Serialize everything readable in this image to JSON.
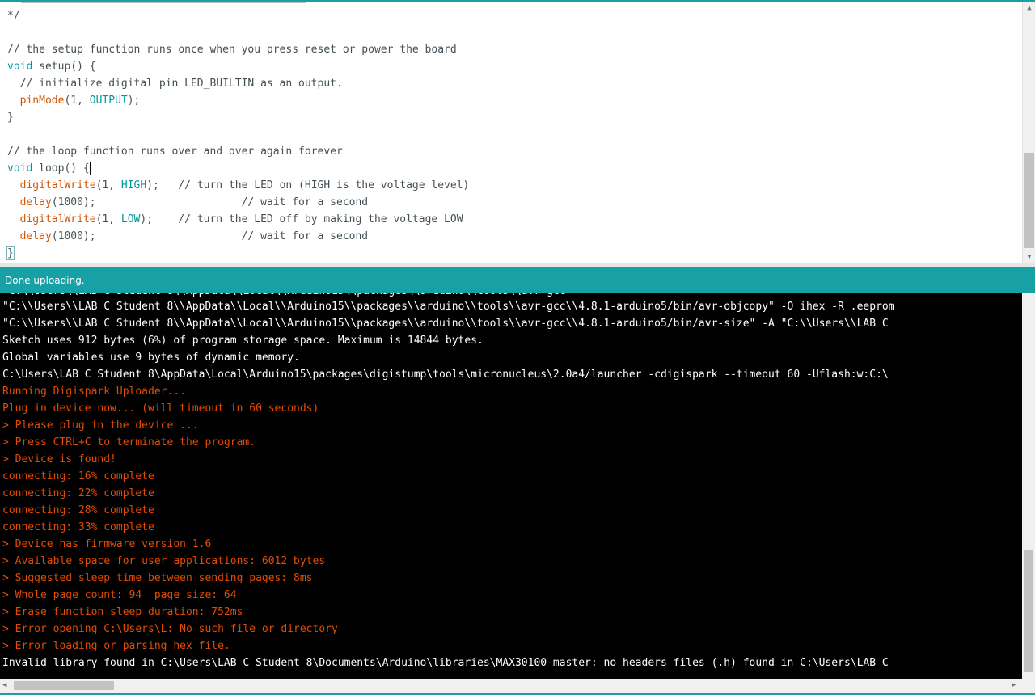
{
  "editor": {
    "lines": [
      {
        "text": "*/"
      },
      {
        "text": ""
      },
      {
        "text": "// the setup function runs once when you press reset or power the board"
      },
      {
        "kw": "void",
        "rest": " setup() {"
      },
      {
        "text": "  // initialize digital pin LED_BUILTIN as an output."
      },
      {
        "fn": "pinMode",
        "a": "(1, ",
        "const": "OUTPUT",
        "b": ");"
      },
      {
        "text": "}"
      },
      {
        "text": ""
      },
      {
        "text": "// the loop function runs over and over again forever"
      },
      {
        "kw": "void",
        "rest": " loop() {"
      },
      {
        "fn": "digitalWrite",
        "a": "(1, ",
        "const": "HIGH",
        "b": ");   // turn the LED on (HIGH is the voltage level)"
      },
      {
        "fn": "delay",
        "a": "(1000);                       // wait for a second"
      },
      {
        "fn": "digitalWrite",
        "a": "(1, ",
        "const": "LOW",
        "b": ");    // turn the LED off by making the voltage LOW"
      },
      {
        "fn": "delay",
        "a": "(1000);                       // wait for a second"
      },
      {
        "text": "}"
      }
    ]
  },
  "status": {
    "text": "Done uploading."
  },
  "console": {
    "lines": [
      {
        "color": "white",
        "text": "\"C:\\\\Users\\\\LAB C Student 8\\\\AppData\\\\Local\\\\Arduino15\\\\packages\\\\arduino\\\\tools\\\\avr-gcc\\\\4.8.1-arduino5/bin/avr-objcopy\" -O ihex -R .eeprom"
      },
      {
        "color": "white",
        "text": "\"C:\\\\Users\\\\LAB C Student 8\\\\AppData\\\\Local\\\\Arduino15\\\\packages\\\\arduino\\\\tools\\\\avr-gcc\\\\4.8.1-arduino5/bin/avr-size\" -A \"C:\\\\Users\\\\LAB C"
      },
      {
        "color": "white",
        "text": "Sketch uses 912 bytes (6%) of program storage space. Maximum is 14844 bytes."
      },
      {
        "color": "white",
        "text": "Global variables use 9 bytes of dynamic memory."
      },
      {
        "color": "white",
        "text": "C:\\Users\\LAB C Student 8\\AppData\\Local\\Arduino15\\packages\\digistump\\tools\\micronucleus\\2.0a4/launcher -cdigispark --timeout 60 -Uflash:w:C:\\"
      },
      {
        "color": "orange",
        "text": "Running Digispark Uploader..."
      },
      {
        "color": "orange",
        "text": "Plug in device now... (will timeout in 60 seconds)"
      },
      {
        "color": "orange",
        "text": "> Please plug in the device ..."
      },
      {
        "color": "orange",
        "text": "> Press CTRL+C to terminate the program."
      },
      {
        "color": "orange",
        "text": "> Device is found!"
      },
      {
        "color": "orange",
        "text": "connecting: 16% complete"
      },
      {
        "color": "orange",
        "text": "connecting: 22% complete"
      },
      {
        "color": "orange",
        "text": "connecting: 28% complete"
      },
      {
        "color": "orange",
        "text": "connecting: 33% complete"
      },
      {
        "color": "orange",
        "text": "> Device has firmware version 1.6"
      },
      {
        "color": "orange",
        "text": "> Available space for user applications: 6012 bytes"
      },
      {
        "color": "orange",
        "text": "> Suggested sleep time between sending pages: 8ms"
      },
      {
        "color": "orange",
        "text": "> Whole page count: 94  page size: 64"
      },
      {
        "color": "orange",
        "text": "> Erase function sleep duration: 752ms"
      },
      {
        "color": "orange",
        "text": "> Error opening C:\\Users\\L: No such file or directory"
      },
      {
        "color": "orange",
        "text": "> Error loading or parsing hex file."
      },
      {
        "color": "white",
        "text": "Invalid library found in C:\\Users\\LAB C Student 8\\Documents\\Arduino\\libraries\\MAX30100-master: no headers files (.h) found in C:\\Users\\LAB C"
      }
    ]
  },
  "colors": {
    "accent": "#17a1a5",
    "console_bg": "#000000",
    "console_text": "#ffffff",
    "console_error": "#e34c00",
    "keyword": "#00979c",
    "function": "#d35400"
  }
}
